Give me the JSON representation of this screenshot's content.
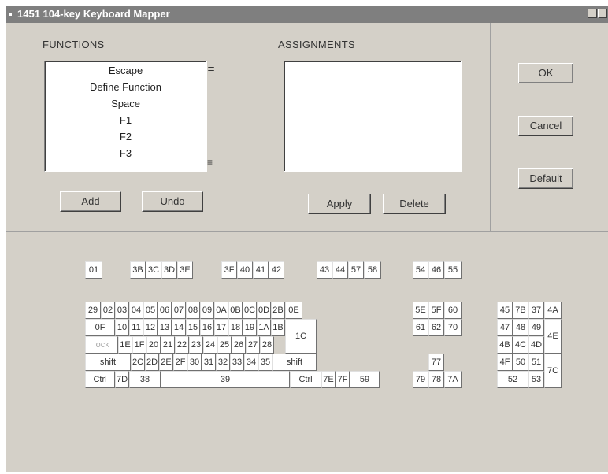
{
  "window": {
    "title": "1451 104-key Keyboard Mapper"
  },
  "functions": {
    "label": "FUNCTIONS",
    "items": [
      "Escape",
      "Define Function",
      "Space",
      "F1",
      "F2",
      "F3"
    ],
    "add_label": "Add",
    "undo_label": "Undo"
  },
  "assignments": {
    "label": "ASSIGNMENTS",
    "items": [],
    "apply_label": "Apply",
    "delete_label": "Delete"
  },
  "dialog": {
    "ok_label": "OK",
    "cancel_label": "Cancel",
    "default_label": "Default"
  },
  "keyboard": {
    "keys": [
      {
        "label": "01"
      },
      {
        "label": "3B"
      },
      {
        "label": "3C"
      },
      {
        "label": "3D"
      },
      {
        "label": "3E"
      },
      {
        "label": "3F"
      },
      {
        "label": "40"
      },
      {
        "label": "41"
      },
      {
        "label": "42"
      },
      {
        "label": "43"
      },
      {
        "label": "44"
      },
      {
        "label": "57"
      },
      {
        "label": "58"
      },
      {
        "label": "54"
      },
      {
        "label": "46"
      },
      {
        "label": "55"
      },
      {
        "label": "29"
      },
      {
        "label": "02"
      },
      {
        "label": "03"
      },
      {
        "label": "04"
      },
      {
        "label": "05"
      },
      {
        "label": "06"
      },
      {
        "label": "07"
      },
      {
        "label": "08"
      },
      {
        "label": "09"
      },
      {
        "label": "0A"
      },
      {
        "label": "0B"
      },
      {
        "label": "0C"
      },
      {
        "label": "0D"
      },
      {
        "label": "2B"
      },
      {
        "label": "0E"
      },
      {
        "label": "5E"
      },
      {
        "label": "5F"
      },
      {
        "label": "60"
      },
      {
        "label": "45"
      },
      {
        "label": "7B"
      },
      {
        "label": "37"
      },
      {
        "label": "4A"
      },
      {
        "label": "0F"
      },
      {
        "label": "10"
      },
      {
        "label": "11"
      },
      {
        "label": "12"
      },
      {
        "label": "13"
      },
      {
        "label": "14"
      },
      {
        "label": "15"
      },
      {
        "label": "16"
      },
      {
        "label": "17"
      },
      {
        "label": "18"
      },
      {
        "label": "19"
      },
      {
        "label": "1A"
      },
      {
        "label": "1B"
      },
      {
        "label": "1C"
      },
      {
        "label": "61"
      },
      {
        "label": "62"
      },
      {
        "label": "70"
      },
      {
        "label": "47"
      },
      {
        "label": "48"
      },
      {
        "label": "49"
      },
      {
        "label": "4E"
      },
      {
        "label": "lock",
        "disabled": true
      },
      {
        "label": "1E"
      },
      {
        "label": "1F"
      },
      {
        "label": "20"
      },
      {
        "label": "21"
      },
      {
        "label": "22"
      },
      {
        "label": "23"
      },
      {
        "label": "24"
      },
      {
        "label": "25"
      },
      {
        "label": "26"
      },
      {
        "label": "27"
      },
      {
        "label": "28"
      },
      {
        "label": "4B"
      },
      {
        "label": "4C"
      },
      {
        "label": "4D"
      },
      {
        "label": "shift"
      },
      {
        "label": "2C"
      },
      {
        "label": "2D"
      },
      {
        "label": "2E"
      },
      {
        "label": "2F"
      },
      {
        "label": "30"
      },
      {
        "label": "31"
      },
      {
        "label": "32"
      },
      {
        "label": "33"
      },
      {
        "label": "34"
      },
      {
        "label": "35"
      },
      {
        "label": "shift"
      },
      {
        "label": "77"
      },
      {
        "label": "4F"
      },
      {
        "label": "50"
      },
      {
        "label": "51"
      },
      {
        "label": "7C"
      },
      {
        "label": "Ctrl"
      },
      {
        "label": "7D"
      },
      {
        "label": "38"
      },
      {
        "label": "39"
      },
      {
        "label": "Ctrl"
      },
      {
        "label": "7E"
      },
      {
        "label": "7F"
      },
      {
        "label": "59"
      },
      {
        "label": "79"
      },
      {
        "label": "78"
      },
      {
        "label": "7A"
      },
      {
        "label": "52"
      },
      {
        "label": "53"
      }
    ]
  }
}
